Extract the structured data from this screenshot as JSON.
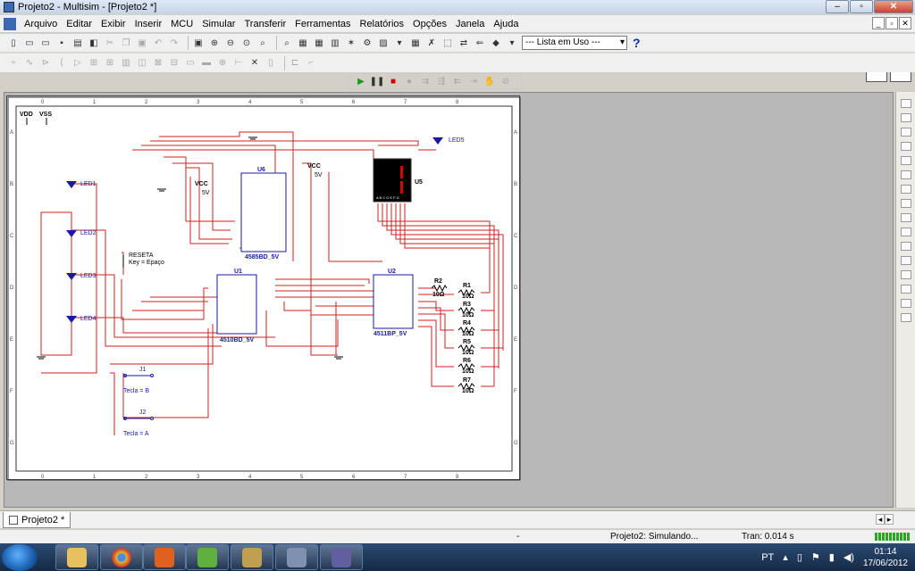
{
  "window": {
    "title": "Projeto2 - Multisim - [Projeto2 *]"
  },
  "menu": [
    "Arquivo",
    "Editar",
    "Exibir",
    "Inserir",
    "MCU",
    "Simular",
    "Transferir",
    "Ferramentas",
    "Relatórios",
    "Opções",
    "Janela",
    "Ajuda"
  ],
  "toolbar": {
    "in_use_list": "--- Lista em Uso ---",
    "help": "?"
  },
  "sheet": {
    "col_numbers": [
      "0",
      "1",
      "2",
      "3",
      "4",
      "5",
      "6",
      "7",
      "8"
    ],
    "row_letters": [
      "A",
      "B",
      "C",
      "D",
      "E",
      "F",
      "G"
    ],
    "labels": {
      "vdd": "VDD",
      "vss": "VSS",
      "led1": "LED1",
      "led2": "LED2",
      "led3": "LED3",
      "led4": "LED4",
      "led5": "LED5",
      "vcc1": "VCC",
      "v5_1": "5V",
      "vcc2": "VCC",
      "v5_2": "5V",
      "u6": "U6",
      "u6_part": "4585BD_5V",
      "u5": "U5",
      "u5_pins": "A B C D E F G",
      "reset": "RESETA",
      "reset_key": "Key = Epaço",
      "u1": "U1",
      "u1_part": "4510BD_5V",
      "u2": "U2",
      "u2_part": "4511BP_5V",
      "r1": "R1",
      "r2": "R2",
      "r3": "R3",
      "r4": "R4",
      "r5": "R5",
      "r6": "R6",
      "r7": "R7",
      "ohm": "10Ω",
      "j1": "J1",
      "j1_key": "Tecla = B",
      "j2": "J2",
      "j2_key": "Tecla = A"
    }
  },
  "tabs": [
    {
      "label": "Projeto2 *"
    }
  ],
  "status": {
    "dash": "-",
    "text": "Projeto2: Simulando...",
    "tran": "Tran: 0.014 s"
  },
  "taskbar": {
    "lang": "PT",
    "time": "01:14",
    "date": "17/06/2012"
  },
  "colors": {
    "wire": "#cc2222",
    "part": "#1a1aa0",
    "desktop": "#b8b8b8"
  }
}
